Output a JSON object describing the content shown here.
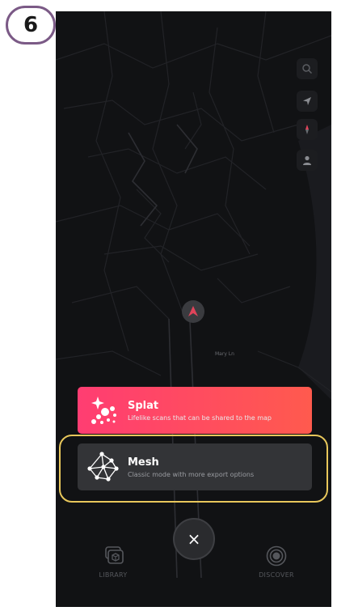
{
  "step": "6",
  "map": {
    "street_label": "Mary Ln"
  },
  "map_controls": [
    "search-icon",
    "locate-icon",
    "compass-icon",
    "profile-icon"
  ],
  "capture_modes": [
    {
      "title": "Splat",
      "subtitle": "Lifelike scans that can be shared to the map",
      "icon": "splat-icon",
      "color": "#ff4a62"
    },
    {
      "title": "Mesh",
      "subtitle": "Classic mode with more export options",
      "icon": "mesh-icon",
      "color": "#333437"
    }
  ],
  "close_button": {
    "label": "×"
  },
  "bottom_nav": [
    {
      "label": "LIBRARY",
      "icon": "library-icon"
    },
    {
      "label": "DISCOVER",
      "icon": "discover-icon"
    }
  ],
  "highlight_color": "#e8c75b"
}
